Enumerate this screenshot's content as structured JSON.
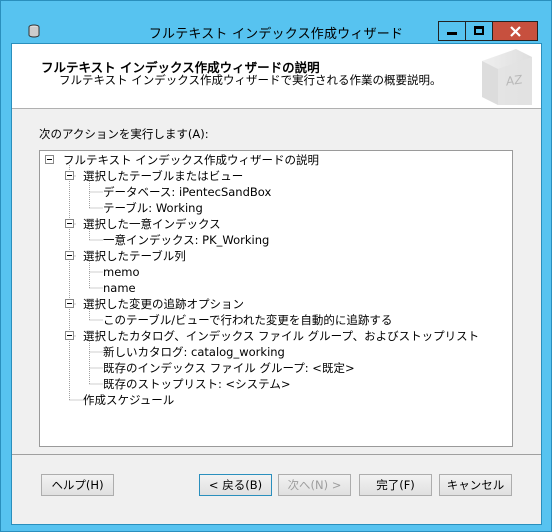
{
  "window": {
    "title": "フルテキスト インデックス作成ウィザード"
  },
  "header": {
    "title": "フルテキスト インデックス作成ウィザードの説明",
    "subtitle": "フルテキスト インデックス作成ウィザードで実行される作業の概要説明。",
    "book_label": "AZ"
  },
  "main": {
    "actions_label": "次のアクションを実行します(A):"
  },
  "tree": {
    "root": "フルテキスト インデックス作成ウィザードの説明",
    "groups": [
      {
        "label": "選択したテーブルまたはビュー",
        "children": [
          "データベース: iPentecSandBox",
          "テーブル: Working"
        ]
      },
      {
        "label": "選択した一意インデックス",
        "children": [
          "一意インデックス: PK_Working"
        ]
      },
      {
        "label": "選択したテーブル列",
        "children": [
          "memo",
          "name"
        ]
      },
      {
        "label": "選択した変更の追跡オプション",
        "children": [
          "このテーブル/ビューで行われた変更を自動的に追跡する"
        ]
      },
      {
        "label": "選択したカタログ、インデックス ファイル グループ、およびストップリスト",
        "children": [
          "新しいカタログ: catalog_working",
          "既存のインデックス ファイル グループ: <既定>",
          "既存のストップリスト: <システム>"
        ]
      }
    ],
    "schedule": "作成スケジュール"
  },
  "footer": {
    "help": "ヘルプ(H)",
    "back": "< 戻る(B)",
    "next": "次へ(N) >",
    "finish": "完了(F)",
    "cancel": "キャンセル"
  }
}
